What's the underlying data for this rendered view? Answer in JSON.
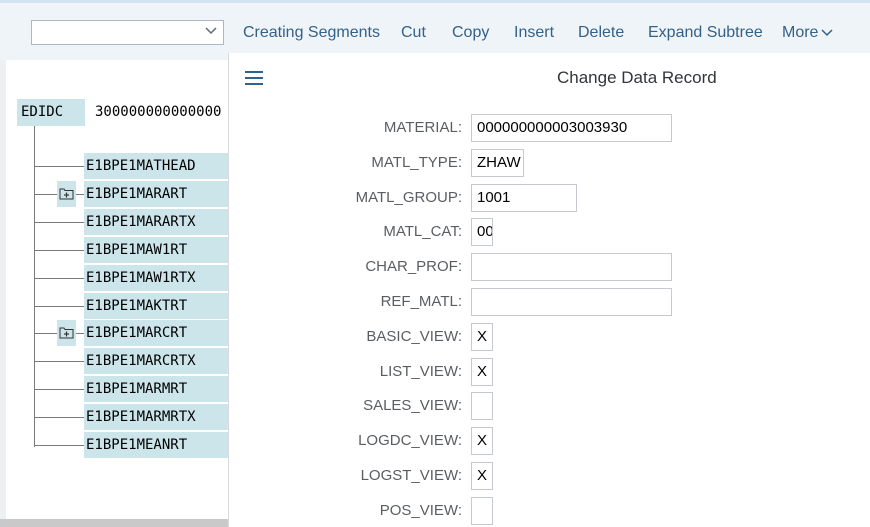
{
  "toolbar": {
    "dropdown_value": "",
    "buttons": [
      "Creating Segments",
      "Cut",
      "Copy",
      "Insert",
      "Delete",
      "Expand Subtree",
      "More"
    ]
  },
  "tree": {
    "root_label": "EDIDC",
    "root_value": "300000000000000",
    "children": [
      {
        "label": "E1BPE1MATHEAD",
        "expandable": false
      },
      {
        "label": "E1BPE1MARART",
        "expandable": true
      },
      {
        "label": "E1BPE1MARARTX",
        "expandable": false
      },
      {
        "label": "E1BPE1MAW1RT",
        "expandable": false
      },
      {
        "label": "E1BPE1MAW1RTX",
        "expandable": false
      },
      {
        "label": "E1BPE1MAKTRT",
        "expandable": false
      },
      {
        "label": "E1BPE1MARCRT",
        "expandable": true
      },
      {
        "label": "E1BPE1MARCRTX",
        "expandable": false
      },
      {
        "label": "E1BPE1MARMRT",
        "expandable": false
      },
      {
        "label": "E1BPE1MARMRTX",
        "expandable": false
      },
      {
        "label": "E1BPE1MEANRT",
        "expandable": false
      }
    ]
  },
  "form": {
    "title": "Change Data Record",
    "fields": [
      {
        "label": "MATERIAL:",
        "value": "000000000003003930",
        "size": "xl"
      },
      {
        "label": "MATL_TYPE:",
        "value": "ZHAW",
        "size": "m"
      },
      {
        "label": "MATL_GROUP:",
        "value": "1001",
        "size": "l"
      },
      {
        "label": "MATL_CAT:",
        "value": "00",
        "size": "s"
      },
      {
        "label": "CHAR_PROF:",
        "value": "",
        "size": "xl"
      },
      {
        "label": "REF_MATL:",
        "value": "",
        "size": "xl"
      },
      {
        "label": "BASIC_VIEW:",
        "value": "X",
        "size": "s"
      },
      {
        "label": "LIST_VIEW:",
        "value": "X",
        "size": "s"
      },
      {
        "label": "SALES_VIEW:",
        "value": "",
        "size": "s"
      },
      {
        "label": "LOGDC_VIEW:",
        "value": "X",
        "size": "s"
      },
      {
        "label": "LOGST_VIEW:",
        "value": "X",
        "size": "s"
      },
      {
        "label": "POS_VIEW:",
        "value": "",
        "size": "s"
      }
    ]
  },
  "colors": {
    "accent": "#346187",
    "tree_highlight": "#cbe5ea",
    "toolbar_bg": "#eff4f9"
  }
}
